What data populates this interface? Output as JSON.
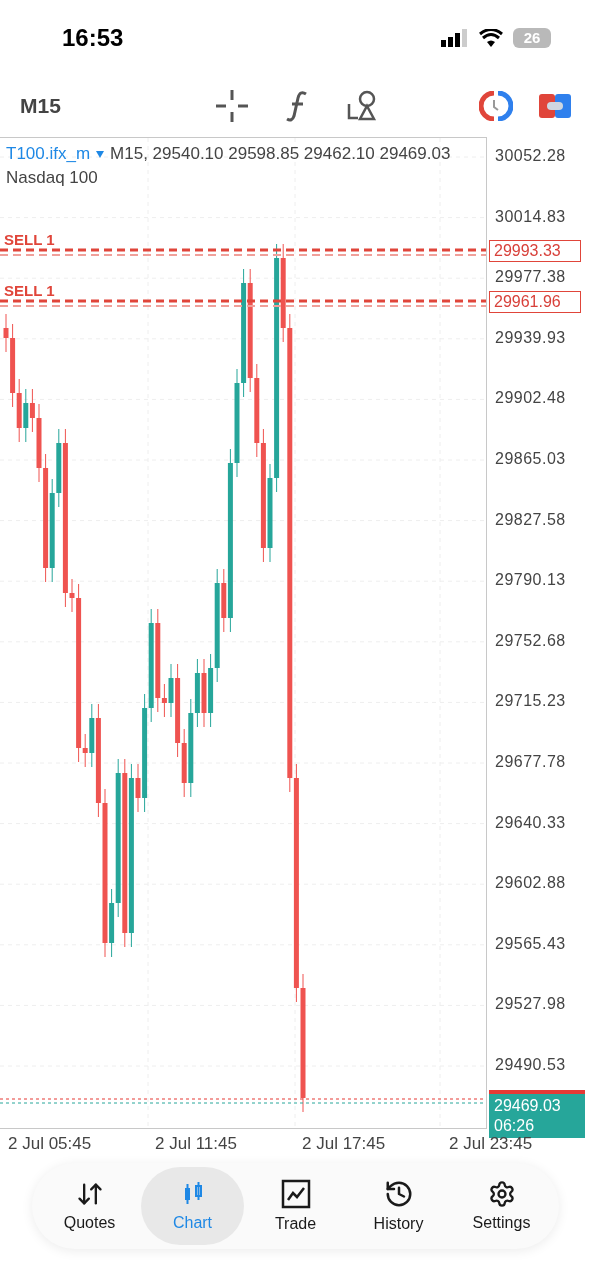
{
  "status_bar": {
    "time": "16:53",
    "battery": "26"
  },
  "toolbar": {
    "timeframe": "M15"
  },
  "chart": {
    "symbol": "T100.ifx_m",
    "info": "M15, 29540.10 29598.85 29462.10 29469.03",
    "description": "Nasdaq 100",
    "price_ticks": [
      "30052.28",
      "30014.83",
      "29977.38",
      "29939.93",
      "29902.48",
      "29865.03",
      "29827.58",
      "29790.13",
      "29752.68",
      "29715.23",
      "29677.78",
      "29640.33",
      "29602.88",
      "29565.43",
      "29527.98",
      "29490.53"
    ],
    "time_labels": [
      "2 Jul 05:45",
      "2 Jul 11:45",
      "2 Jul 17:45",
      "2 Jul 23:45"
    ],
    "orders": [
      {
        "label": "SELL 1",
        "price": "29993.33"
      },
      {
        "label": "SELL 1",
        "price": "29961.96"
      }
    ],
    "current": {
      "price": "29469.03",
      "countdown": "06:26"
    }
  },
  "nav": [
    {
      "label": "Quotes",
      "selected": false
    },
    {
      "label": "Chart",
      "selected": true
    },
    {
      "label": "Trade",
      "selected": false
    },
    {
      "label": "History",
      "selected": false
    },
    {
      "label": "Settings",
      "selected": false
    }
  ]
}
